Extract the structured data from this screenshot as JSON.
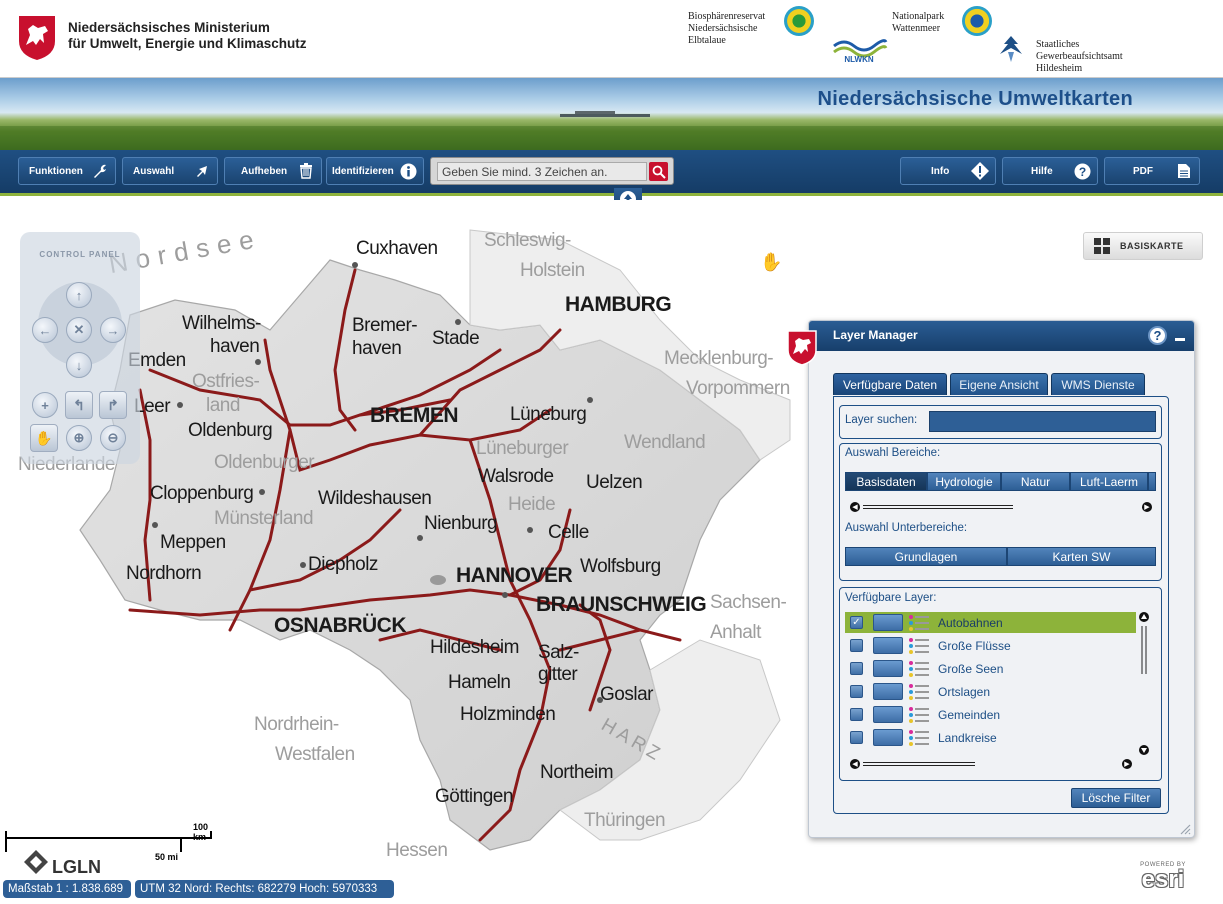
{
  "header": {
    "ministry_line1": "Niedersächsisches Ministerium",
    "ministry_line2": "für Umwelt, Energie und Klimaschutz",
    "partners": {
      "biosphaere": [
        "Biosphärenreservat",
        "Niedersächsische",
        "Elbtalaue"
      ],
      "nationalpark": [
        "Nationalpark",
        "Wattenmeer"
      ],
      "nlwkn": "NLWKN",
      "gewerbe": [
        "Staatliches",
        "Gewerbeaufsichtsamt",
        "Hildesheim"
      ]
    }
  },
  "banner": {
    "title": "Niedersächsische Umweltkarten"
  },
  "toolbar": {
    "funktionen": "Funktionen",
    "auswahl": "Auswahl",
    "aufheben": "Aufheben",
    "identifizieren": "Identifizieren",
    "search_value": "Geben Sie mind. 3 Zeichen an.",
    "info": "Info",
    "hilfe": "Hilfe",
    "pdf": "PDF"
  },
  "control_panel": {
    "title": "CONTROL PANEL"
  },
  "basiskarte": {
    "label": "BASISKARTE"
  },
  "map": {
    "places_big": [
      "Cuxhaven",
      "HAMBURG",
      "Wilhelms-",
      "haven",
      "Bremer-",
      "haven",
      "Stade",
      "Emden",
      "Leer",
      "BREMEN",
      "Lüneburg",
      "Oldenburg",
      "Walsrode",
      "Uelzen",
      "Cloppenburg",
      "Wildeshausen",
      "Nienburg",
      "Celle",
      "Meppen",
      "Diepholz",
      "HANNOVER",
      "Wolfsburg",
      "Nordhorn",
      "BRAUNSCHWEIG",
      "OSNABRÜCK",
      "Hildesheim",
      "Salz-",
      "gitter",
      "Hameln",
      "Goslar",
      "Holzminden",
      "Northeim",
      "Göttingen"
    ],
    "places_gray": [
      "Nordsee",
      "Schleswig-",
      "Holstein",
      "Mecklenburg-",
      "Vorpommern",
      "Ostfries-",
      "land",
      "Lüneburger",
      "Heide",
      "Wendland",
      "Niederlande",
      "Oldenburger",
      "Münsterland",
      "Sachsen-",
      "Anhalt",
      "Nordrhein-",
      "Westfalen",
      "HARZ",
      "Thüringen",
      "Hessen"
    ]
  },
  "layer_manager": {
    "title": "Layer Manager",
    "tabs": [
      "Verfügbare Daten",
      "Eigene Ansicht",
      "WMS Dienste"
    ],
    "search_label": "Layer suchen:",
    "bereiche_label": "Auswahl Bereiche:",
    "bereiche": [
      "Basisdaten",
      "Hydrologie",
      "Natur",
      "Luft-Laerm"
    ],
    "unterbereiche_label": "Auswahl Unterbereiche:",
    "unterbereiche": [
      "Grundlagen",
      "Karten SW"
    ],
    "layers_label": "Verfügbare Layer:",
    "layers": [
      {
        "name": "Autobahnen",
        "checked": true,
        "selected": true
      },
      {
        "name": "Große Flüsse",
        "checked": false,
        "selected": false
      },
      {
        "name": "Große Seen",
        "checked": false,
        "selected": false
      },
      {
        "name": "Ortslagen",
        "checked": false,
        "selected": false
      },
      {
        "name": "Gemeinden",
        "checked": false,
        "selected": false
      },
      {
        "name": "Landkreise",
        "checked": false,
        "selected": false
      }
    ],
    "clear_filter": "Lösche Filter"
  },
  "scale": {
    "km": "100 km",
    "mi": "50 mi"
  },
  "status": {
    "massstab": "Maßstab 1 : 1.838.689",
    "coords": "UTM 32 Nord: Rechts: 682279 Hoch: 5970333"
  },
  "logos": {
    "lgln": "LGLN",
    "esri_powered": "POWERED BY",
    "esri": "esri"
  },
  "colors": {
    "toolbar": "#1f4f82",
    "accent_green": "#8db33a",
    "roads": "#8b1a1a",
    "ministry_red": "#c8102e"
  }
}
